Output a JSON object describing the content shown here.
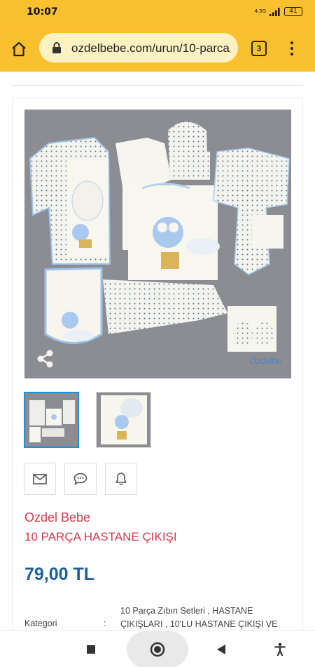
{
  "status_bar": {
    "time": "10:07",
    "network": "4.5G",
    "battery": "41"
  },
  "browser": {
    "url": "ozdelbebe.com/urun/10-parca",
    "tab_count": "3"
  },
  "product": {
    "brand": "Ozdel Bebe",
    "title": "10 PARÇA HASTANE ÇIKIŞI",
    "price": "79,00 TL",
    "category_label": "Kategori",
    "category_separator": ":",
    "category_value": "10 Parça Zıbın Setleri , HASTANE ÇIKIŞLARI , 10'LU HASTANE ÇIKIŞI VE"
  },
  "image_logo_text": "Özdelbe",
  "colors": {
    "browser_bar": "#fbc02d",
    "brand_text": "#d23b4d",
    "price_text": "#1c5f9c",
    "active_thumb_border": "#1e90d6",
    "image_background": "#8a8c91"
  },
  "icons": {
    "home": "home-icon",
    "lock": "lock-icon",
    "menu": "more-vertical-icon",
    "share": "share-icon",
    "mail": "envelope-icon",
    "comment": "comment-icon",
    "bell": "bell-icon",
    "nav_recent": "square-icon",
    "nav_home": "circle-icon",
    "nav_back": "triangle-back-icon",
    "nav_accessibility": "accessibility-icon"
  }
}
